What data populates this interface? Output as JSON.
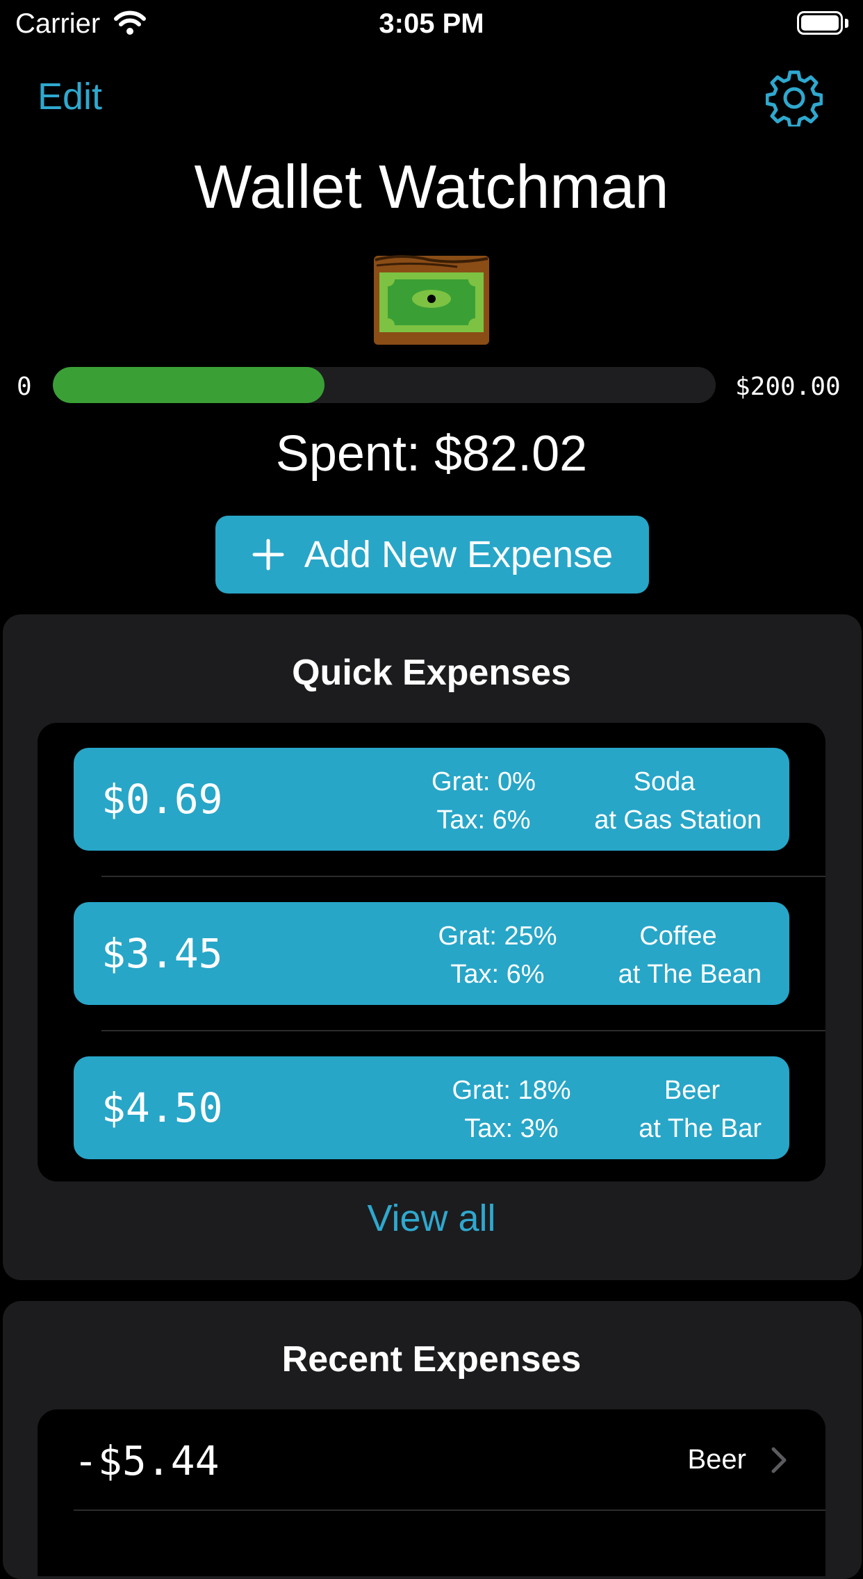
{
  "status_bar": {
    "carrier": "Carrier",
    "time": "3:05 PM"
  },
  "nav": {
    "edit_label": "Edit",
    "settings_icon": "gear-icon"
  },
  "app_title": "Wallet Watchman",
  "budget": {
    "min_label": "0",
    "max_label": "$200.00",
    "progress_fraction": 0.41,
    "spent_text": "Spent: $82.02"
  },
  "add_button": {
    "label": "Add New Expense",
    "icon": "plus-icon"
  },
  "quick_expenses": {
    "title": "Quick Expenses",
    "items": [
      {
        "amount": "$0.69",
        "grat": "Grat: 0%",
        "tax": "Tax: 6%",
        "name": "Soda",
        "place": "at Gas Station"
      },
      {
        "amount": "$3.45",
        "grat": "Grat: 25%",
        "tax": "Tax: 6%",
        "name": "Coffee",
        "place": "at The Bean"
      },
      {
        "amount": "$4.50",
        "grat": "Grat: 18%",
        "tax": "Tax: 3%",
        "name": "Beer",
        "place": "at The Bar"
      }
    ],
    "view_all_label": "View all"
  },
  "recent_expenses": {
    "title": "Recent Expenses",
    "items": [
      {
        "amount": "-$5.44",
        "label": "Beer"
      }
    ]
  },
  "colors": {
    "accent": "#27a6c8",
    "link": "#2fa8cf",
    "progress": "#3aa036",
    "panel": "#1c1c1e"
  }
}
